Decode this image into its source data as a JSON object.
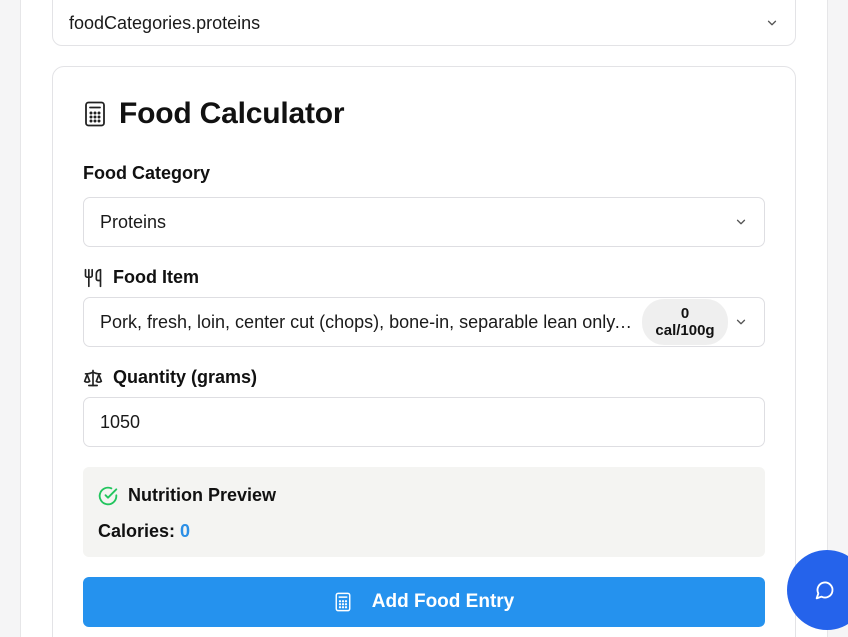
{
  "top_select": {
    "value": "foodCategories.proteins"
  },
  "calculator": {
    "title": "Food Calculator",
    "category": {
      "label": "Food Category",
      "value": "Proteins"
    },
    "food_item": {
      "label": "Food Item",
      "value": "Pork, fresh, loin, center cut (chops), bone-in, separable lean only, co…",
      "badge_value": "0",
      "badge_unit": "cal/100g"
    },
    "quantity": {
      "label": "Quantity (grams)",
      "value": "1050"
    },
    "preview": {
      "title": "Nutrition Preview",
      "calories_label": "Calories:",
      "calories_value": "0"
    },
    "add_button_label": "Add Food Entry"
  },
  "colors": {
    "accent": "#2592ee",
    "calories": "#2b8fe6",
    "check": "#22c55e",
    "fab": "#2563eb"
  },
  "icons": [
    "chevron-down-icon",
    "calculator-icon",
    "utensils-icon",
    "scale-icon",
    "check-circle-icon",
    "message-circle-icon"
  ]
}
